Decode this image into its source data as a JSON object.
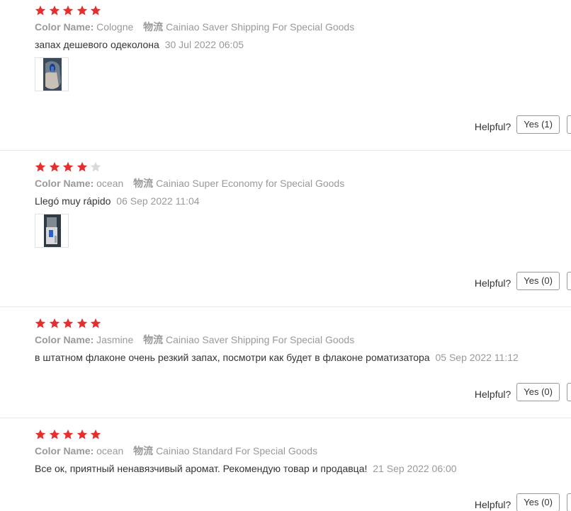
{
  "labels": {
    "color_name": "Color Name:",
    "logistics": "物流",
    "helpful": "Helpful?"
  },
  "colors": {
    "star_filled": "#e62e2e",
    "star_empty": "#d9d9d9"
  },
  "reviews": [
    {
      "rating": 5,
      "color_name": "Cologne",
      "shipping": "Cainiao Saver Shipping For Special Goods",
      "text": "запах дешевого одеколона",
      "date": "30 Jul 2022 06:05",
      "has_photo": true,
      "yes_label": "Yes (1)"
    },
    {
      "rating": 4,
      "color_name": "ocean",
      "shipping": "Cainiao Super Economy for Special Goods",
      "text": "Llegó muy rápido",
      "date": "06 Sep 2022 11:04",
      "has_photo": true,
      "yes_label": "Yes (0)"
    },
    {
      "rating": 5,
      "color_name": "Jasmine",
      "shipping": "Cainiao Saver Shipping For Special Goods",
      "text": "в штатном флаконе очень резкий запах, посмотри как будет в флаконе роматизатора",
      "date": "05 Sep 2022 11:12",
      "has_photo": false,
      "yes_label": "Yes (0)"
    },
    {
      "rating": 5,
      "color_name": "ocean",
      "shipping": "Cainiao Standard For Special Goods",
      "text": "Все ок, приятный ненавязчивый аромат. Рекомендую товар и продавца!",
      "date": "21 Sep 2022 06:00",
      "has_photo": false,
      "yes_label": "Yes (0)"
    }
  ]
}
